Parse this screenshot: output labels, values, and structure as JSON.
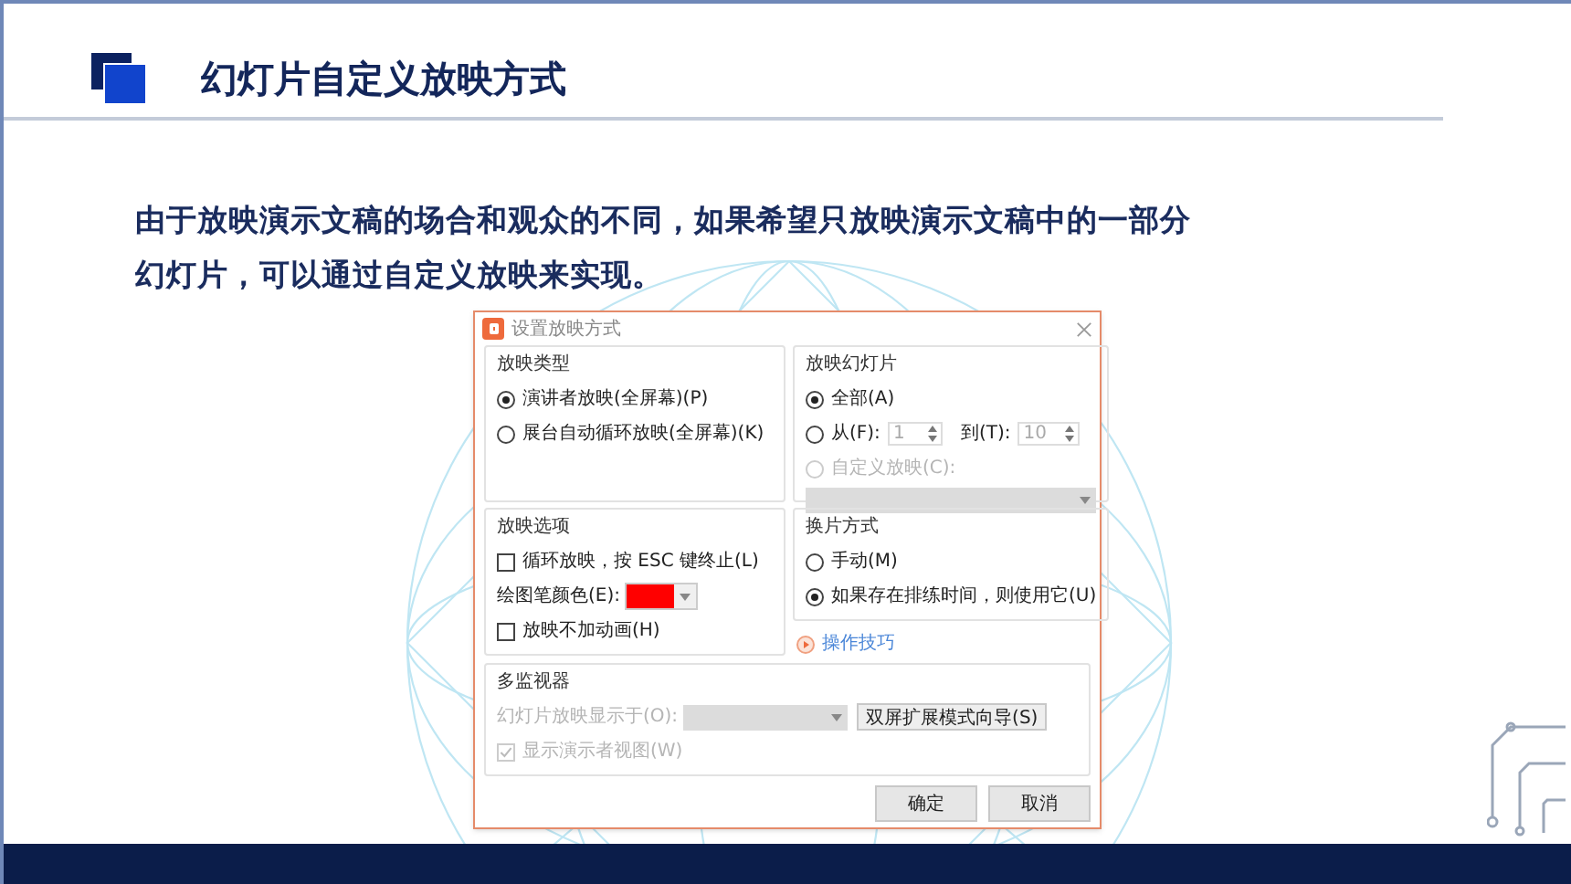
{
  "slide": {
    "title": "幻灯片自定义放映方式",
    "paragraph": "由于放映演示文稿的场合和观众的不同，如果希望只放映演示文稿中的一部分幻灯片，可以通过自定义放映来实现。"
  },
  "dialog": {
    "title": "设置放映方式",
    "show_type": {
      "label": "放映类型",
      "options": [
        {
          "label": "演讲者放映(全屏幕)(P)",
          "selected": true
        },
        {
          "label": "展台自动循环放映(全屏幕)(K)",
          "selected": false
        }
      ]
    },
    "slides": {
      "label": "放映幻灯片",
      "options": [
        {
          "kind": "all",
          "label": "全部(A)",
          "selected": true
        },
        {
          "kind": "range",
          "label": "从(F):",
          "selected": false,
          "from": "1",
          "to_label": "到(T):",
          "to": "10"
        },
        {
          "kind": "custom",
          "label": "自定义放映(C):",
          "selected": false,
          "disabled": true
        }
      ]
    },
    "options": {
      "label": "放映选项",
      "items": [
        {
          "kind": "checkbox",
          "label": "循环放映，按 ESC 键终止(L)",
          "checked": false
        },
        {
          "kind": "color",
          "label": "绘图笔颜色(E):",
          "color": "#ff0000"
        },
        {
          "kind": "checkbox",
          "label": "放映不加动画(H)",
          "checked": false
        }
      ]
    },
    "advance": {
      "label": "换片方式",
      "options": [
        {
          "label": "手动(M)",
          "selected": false
        },
        {
          "label": "如果存在排练时间，则使用它(U)",
          "selected": true
        }
      ]
    },
    "tips_link": "操作技巧",
    "monitors": {
      "label": "多监视器",
      "display_label": "幻灯片放映显示于(O):",
      "display_disabled": true,
      "wizard_button": "双屏扩展模式向导(S)",
      "presenter_view": {
        "label": "显示演示者视图(W)",
        "checked": true,
        "disabled": true
      }
    },
    "buttons": [
      {
        "label": "确定"
      },
      {
        "label": "取消"
      }
    ]
  }
}
